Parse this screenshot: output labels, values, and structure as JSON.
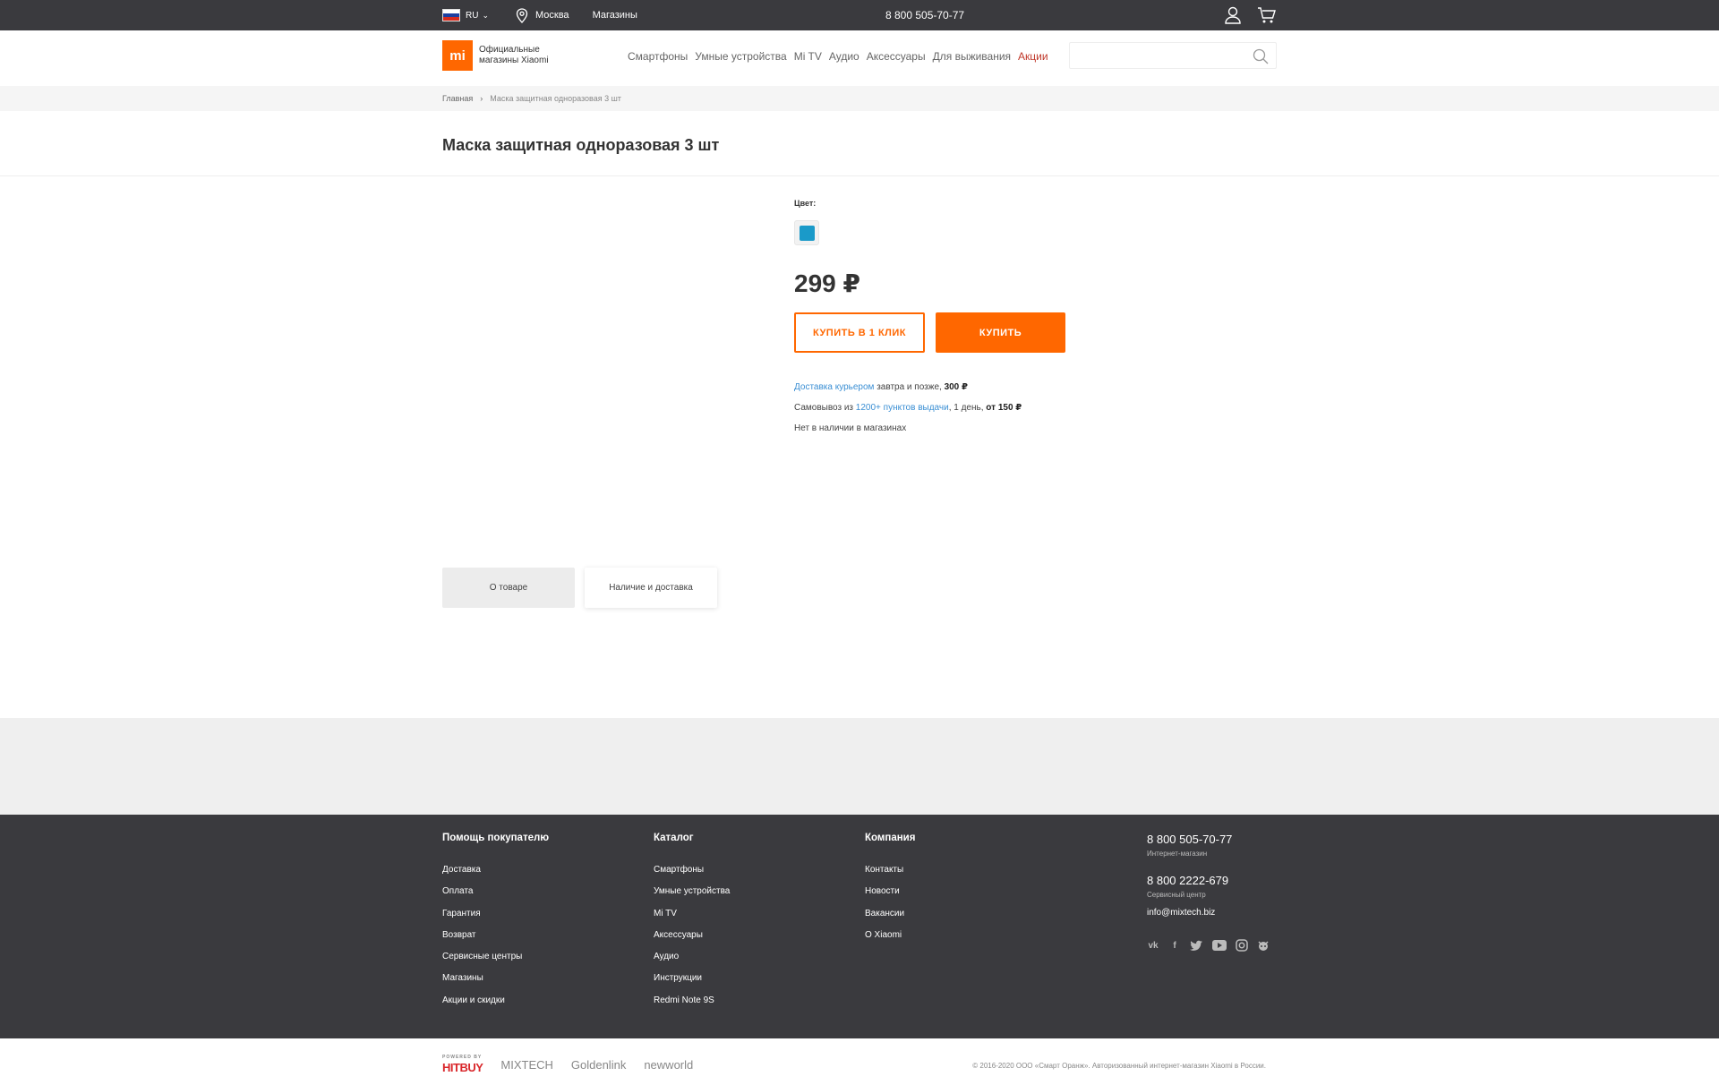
{
  "topbar": {
    "lang": "RU",
    "city": "Москва",
    "stores": "Магазины",
    "phone": "8 800 505-70-77"
  },
  "header": {
    "logo_mark": "mi",
    "logo_text_1": "Официальные",
    "logo_text_2": "магазины Xiaomi",
    "nav": [
      "Смартфоны",
      "Умные устройства",
      "Mi TV",
      "Аудио",
      "Аксессуары",
      "Для выживания",
      "Акции"
    ],
    "search_placeholder": ""
  },
  "breadcrumb": {
    "home": "Главная",
    "current": "Маска защитная одноразовая 3 шт"
  },
  "product": {
    "title": "Маска защитная одноразовая 3 шт",
    "color_label": "Цвет:",
    "swatch_color": "#1a9ac9",
    "price": "299 ₽",
    "btn_oneclick": "КУПИТЬ В 1 КЛИК",
    "btn_buy": "КУПИТЬ",
    "delivery_courier_link": "Доставка курьером",
    "delivery_courier_text": " завтра и позже, ",
    "delivery_courier_price": "300 ₽",
    "pickup_text": "Самовывоз из ",
    "pickup_link": "1200+ пунктов выдачи",
    "pickup_tail": ", 1 день, ",
    "pickup_price": "от 150 ₽",
    "stock": "Нет в наличии в магазинах"
  },
  "tabs": {
    "about": "О товаре",
    "delivery": "Наличие и доставка"
  },
  "footer": {
    "help": {
      "title": "Помощь покупателю",
      "items": [
        "Доставка",
        "Оплата",
        "Гарантия",
        "Возврат",
        "Сервисные центры",
        "Магазины",
        "Акции и скидки"
      ]
    },
    "catalog": {
      "title": "Каталог",
      "items": [
        "Смартфоны",
        "Умные устройства",
        "Mi TV",
        "Аксессуары",
        "Аудио",
        "Инструкции",
        "Redmi Note 9S"
      ]
    },
    "company": {
      "title": "Компания",
      "items": [
        "Контакты",
        "Новости",
        "Вакансии",
        "О Xiaomi"
      ]
    },
    "contacts": {
      "phone1": "8 800 505-70-77",
      "phone1_sub": "Интернет-магазин",
      "phone2": "8 800 2222-679",
      "phone2_sub": "Сервисный центр",
      "email": "info@mixtech.biz"
    }
  },
  "bottom": {
    "powered_by": "POWERED BY",
    "hitbuy": "HITBUY",
    "partners": [
      "MIXTECH",
      "Goldenlink",
      "newworld"
    ],
    "copyright": "© 2016-2020 ООО «Смарт Оранж». Авторизованный интернет-магазин Xiaomi в России."
  },
  "colors": {
    "accent": "#ff6700",
    "dark": "#3a3a3e",
    "link": "#3b8fd4",
    "promo": "#c0392b"
  }
}
